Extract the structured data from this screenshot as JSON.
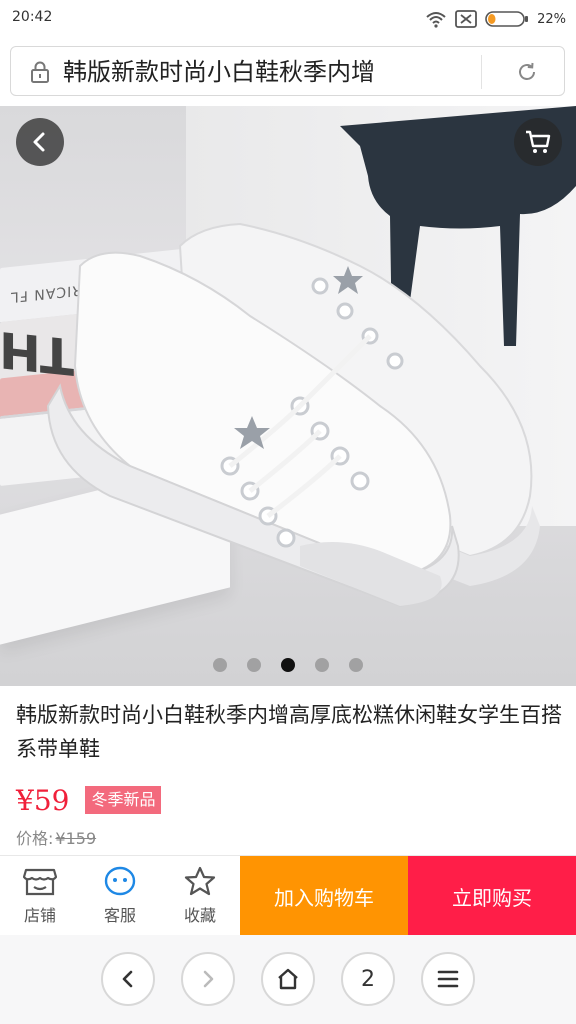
{
  "status_bar": {
    "time": "20:42",
    "battery_percent": "22%",
    "battery_level": 0.22,
    "icons": [
      "wifi-icon",
      "sim-off-icon",
      "battery-icon"
    ]
  },
  "address_bar": {
    "url_text": "韩版新款时尚小白鞋秋季内增",
    "icons": [
      "lock-icon",
      "refresh-icon"
    ]
  },
  "gallery": {
    "image_count": 5,
    "active_index": 2,
    "book_text_small": "ALL-AMERICAN FL",
    "book_text_big": "OUTH",
    "book_text_r": "R",
    "icons": [
      "back-icon",
      "cart-icon"
    ]
  },
  "product": {
    "title": "韩版新款时尚小白鞋秋季内增高厚底松糕休闲鞋女学生百搭系带单鞋",
    "price": "¥59",
    "tag": "冬季新品",
    "original_price_label": "价格:",
    "original_price": "¥159"
  },
  "action_bar": {
    "store_label": "店铺",
    "service_label": "客服",
    "favorite_label": "收藏",
    "add_to_cart_label": "加入购物车",
    "buy_now_label": "立即购买",
    "colors": {
      "add_to_cart": "#ff9402",
      "buy_now": "#ff1e48"
    }
  },
  "browser_nav": {
    "tab_count": "2",
    "icons": [
      "chevron-left-icon",
      "chevron-right-icon",
      "home-icon",
      "menu-icon"
    ]
  }
}
